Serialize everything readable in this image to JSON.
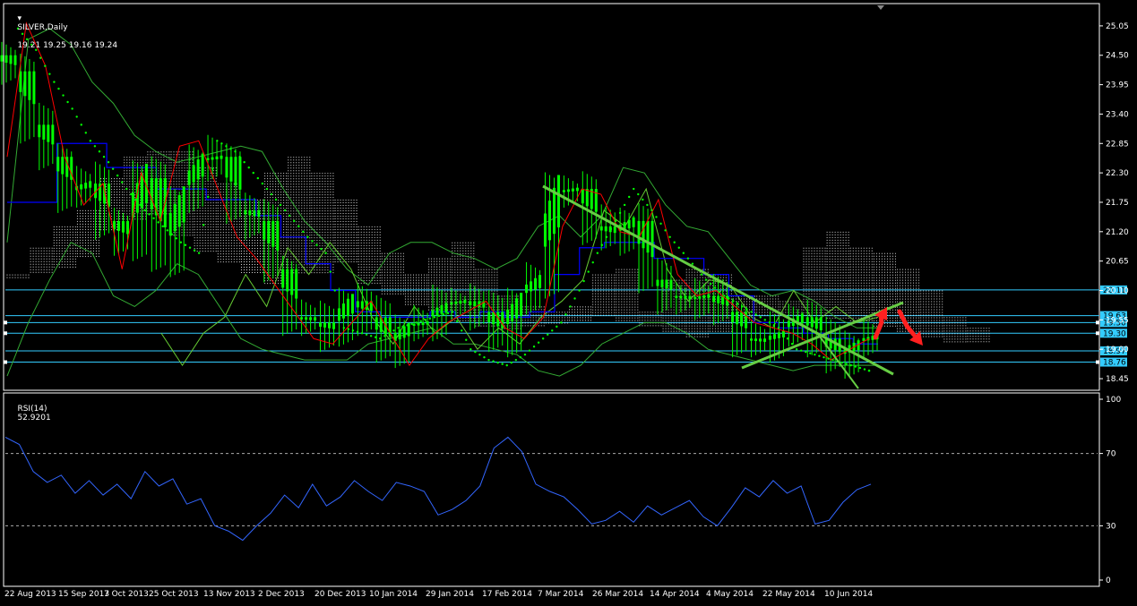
{
  "header": {
    "symbol_label": "SILVER,Daily",
    "ohlc": "19.21 19.25 19.16 19.24"
  },
  "rsi_header": {
    "label": "RSI(14)",
    "value": "52.9201"
  },
  "colors": {
    "background": "#000000",
    "axis": "#ffffff",
    "candles": "#00ff00",
    "tenkan": "#ff0000",
    "kijun": "#0000ff",
    "chikou": "#66cc33",
    "bollinger": "#33aa33",
    "psar": "#00ff00",
    "cloud": "#ffffff",
    "hlines": "#33ccff",
    "rsi": "#3366ff",
    "trendlines": "#66cc44",
    "arrows": "#ff2020"
  },
  "chart_data": [
    {
      "type": "line",
      "title": "SILVER,Daily",
      "x": [
        "22 Aug 2013",
        "15 Sep 2013",
        "7 Oct 2013",
        "25 Oct 2013",
        "13 Nov 2013",
        "2 Dec 2013",
        "20 Dec 2013",
        "10 Jan 2014",
        "29 Jan 2014",
        "17 Feb 2014",
        "7 Mar 2014",
        "26 Mar 2014",
        "14 Apr 2014",
        "4 May 2014",
        "22 May 2014",
        "10 Jun 2014"
      ],
      "y_ticks": [
        "25.05",
        "24.50",
        "23.95",
        "23.40",
        "22.85",
        "22.30",
        "21.75",
        "21.20",
        "20.65",
        "20.10",
        "19.55",
        "19.00",
        "18.45"
      ],
      "ylim": [
        18.3,
        25.4
      ],
      "grid": false,
      "price_labels": [
        "20.11",
        "19.63",
        "19.50",
        "19.30",
        "18.97",
        "18.76"
      ],
      "series": [
        {
          "name": "",
          "values": [
            24.2,
            23.2,
            22.6,
            21.9,
            22.1,
            21.4,
            21.0,
            22.2,
            20.7,
            21.8,
            22.5,
            22.6,
            21.6,
            21.4,
            20.5,
            19.6,
            19.5,
            19.3,
            19.9,
            19.6,
            19.0,
            19.4,
            19.5,
            19.8,
            19.9,
            19.7,
            19.2,
            19.9,
            20.3,
            21.9,
            22.0,
            21.3,
            21.1,
            21.4,
            20.3,
            20.0,
            19.9,
            20.0,
            19.7,
            19.2,
            19.1,
            19.3,
            19.6,
            19.2,
            18.8,
            19.1,
            19.24
          ]
        },
        {
          "name": "",
          "values": [
            22.3,
            21.4,
            21.1,
            19.2,
            19.4,
            20.5,
            20.0,
            19.6,
            19.4,
            19.1,
            19.0,
            18.9,
            19.3,
            19.6,
            19.7,
            19.8,
            19.7,
            19.6,
            20.2,
            20.5,
            21.0,
            20.8,
            20.6,
            20.2,
            19.9,
            19.7,
            19.6,
            19.4,
            19.3,
            19.25,
            19.2
          ]
        }
      ]
    },
    {
      "type": "line",
      "title": "RSI(14) 52.9201",
      "x": [
        "22 Aug 2013",
        "15 Sep 2013",
        "7 Oct 2013",
        "25 Oct 2013",
        "13 Nov 2013",
        "2 Dec 2013",
        "20 Dec 2013",
        "10 Jan 2014",
        "29 Jan 2014",
        "17 Feb 2014",
        "7 Mar 2014",
        "26 Mar 2014",
        "14 Apr 2014",
        "4 May 2014",
        "22 May 2014",
        "10 Jun 2014"
      ],
      "y_ticks": [
        "100",
        "70",
        "30",
        "0"
      ],
      "ylim": [
        0,
        100
      ],
      "levels": [
        70,
        30
      ],
      "series": [
        {
          "name": "RSI(14)",
          "values": [
            79,
            75,
            60,
            54,
            58,
            48,
            55,
            47,
            53,
            45,
            60,
            52,
            56,
            42,
            45,
            30,
            27,
            22,
            30,
            37,
            47,
            40,
            53,
            41,
            46,
            55,
            49,
            44,
            54,
            52,
            49,
            36,
            39,
            44,
            52,
            73,
            79,
            71,
            53,
            49,
            46,
            39,
            31,
            33,
            38,
            32,
            41,
            36,
            40,
            44,
            35,
            30,
            40,
            51,
            46,
            55,
            48,
            52,
            31,
            33,
            43,
            50,
            53
          ]
        }
      ]
    }
  ]
}
